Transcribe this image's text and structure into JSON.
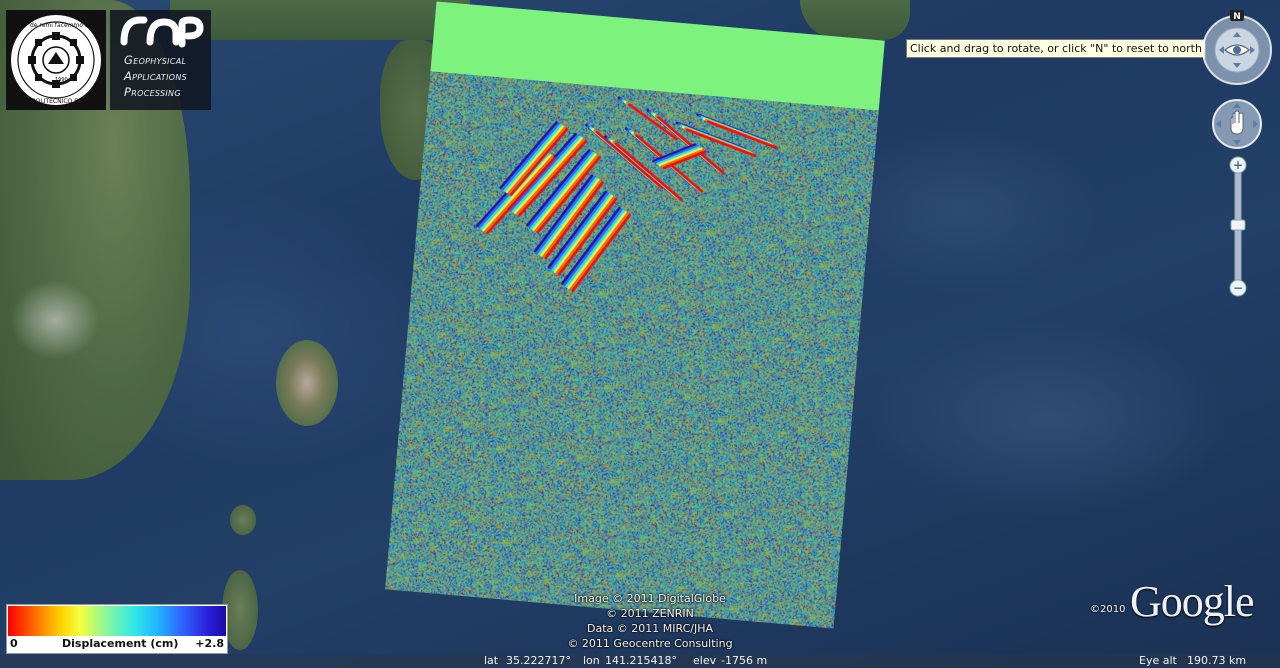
{
  "logos": {
    "poliba": {
      "motto": "de remi facemmo ali",
      "name": "POLITECNICO DI BARI",
      "year": "1990"
    },
    "gap": {
      "line1": "Geophysical",
      "line2": "Applications",
      "line3": "Processing"
    }
  },
  "navigation": {
    "north_label": "N",
    "rotate_tooltip": "Click and drag to rotate, or click \"N\" to reset to north",
    "zoom_in": "+",
    "zoom_out": "−",
    "zoom_level": 0.45
  },
  "legend": {
    "min": "0",
    "label": "Displacement (cm)",
    "max": "+2.8",
    "colors": [
      "#ff0000",
      "#ffd000",
      "#8cf79a",
      "#2fe8e8",
      "#2f63ff",
      "#1a0aa8"
    ]
  },
  "attribution": {
    "line1": "Image © 2011 DigitalGlobe",
    "line2": "© 2011 ZENRIN",
    "line3": "Data © 2011 MIRC/JHA",
    "line4": "© 2011 Geocentre Consulting"
  },
  "google": {
    "logo": "Google",
    "copyright": "©2010"
  },
  "status": {
    "lat_label": "lat",
    "lat": "35.222717°",
    "lon_label": "lon",
    "lon": "141.215418°",
    "elev_label": "elev",
    "elev": "-1756 m",
    "eye_label": "Eye alt",
    "eye_alt": "190.73 km"
  },
  "overlay": {
    "nodata_color": "#7df27d"
  }
}
